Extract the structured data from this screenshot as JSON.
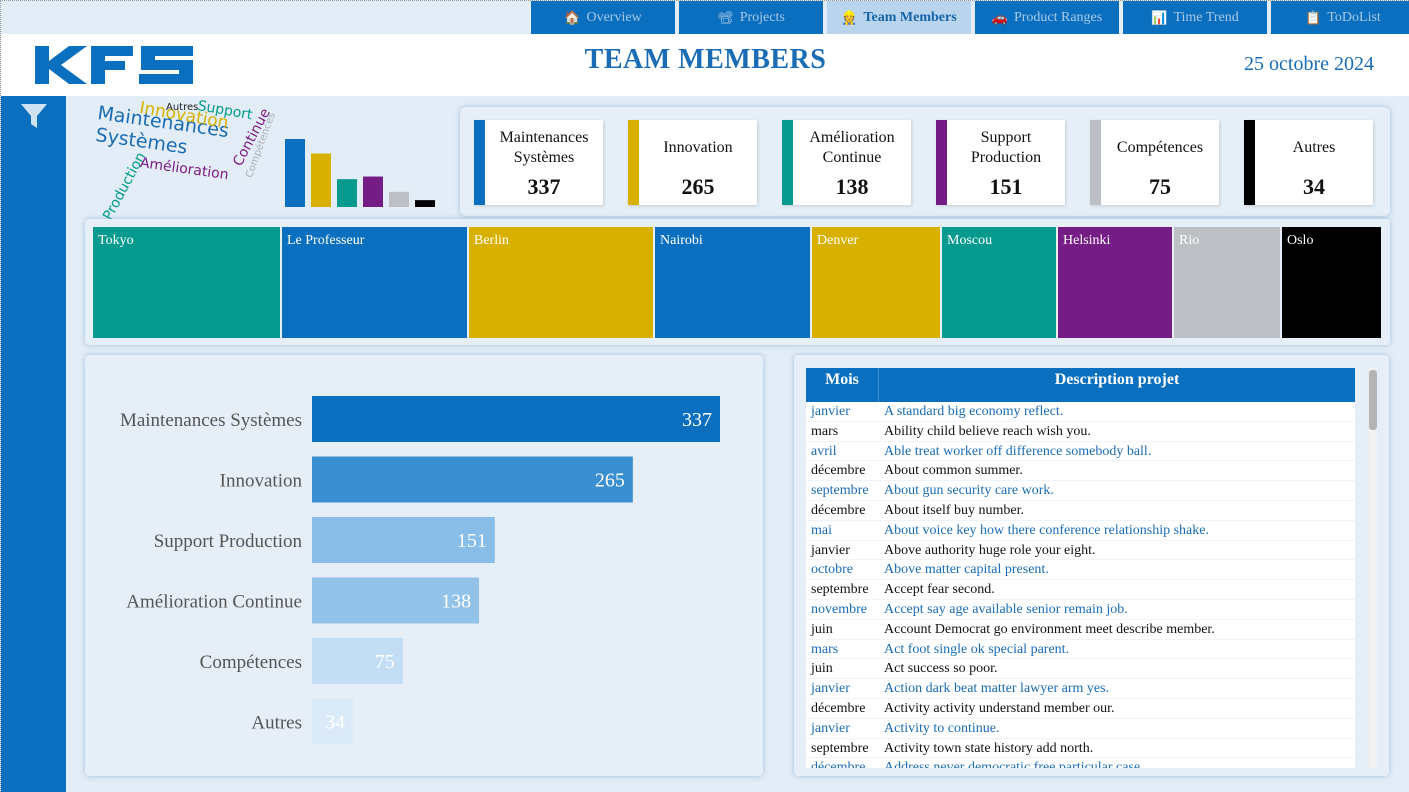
{
  "nav": {
    "tabs": [
      {
        "label": "Overview",
        "icon": "house-icon",
        "glyph": "🏠"
      },
      {
        "label": "Projects",
        "icon": "film-projector-icon",
        "glyph": "📽"
      },
      {
        "label": "Team Members",
        "icon": "team-icon",
        "glyph": "👷"
      },
      {
        "label": "Product Ranges",
        "icon": "car-icon",
        "glyph": "🚗"
      },
      {
        "label": "Time Trend",
        "icon": "chart-icon",
        "glyph": "📊"
      },
      {
        "label": "ToDoList",
        "icon": "notepad-icon",
        "glyph": "📋"
      }
    ],
    "active": "Team Members"
  },
  "header": {
    "logo": "KFS",
    "title": "TEAM MEMBERS",
    "date": "25 octobre 2024"
  },
  "sidebar": {
    "icon": "filter-icon"
  },
  "wordcloud": {
    "words": [
      {
        "text": "Maintenances",
        "color": "#1a6cb5"
      },
      {
        "text": "Systèmes",
        "color": "#1a6cb5"
      },
      {
        "text": "Innovation",
        "color": "#d6b300"
      },
      {
        "text": "Support",
        "color": "#009b8c"
      },
      {
        "text": "Autres",
        "color": "#222222"
      },
      {
        "text": "Continue",
        "color": "#7a1b86"
      },
      {
        "text": "Compétences",
        "color": "#aab0b5"
      },
      {
        "text": "Production",
        "color": "#009b8c"
      },
      {
        "text": "Amélioration",
        "color": "#7a1b86"
      }
    ]
  },
  "kpis": [
    {
      "label": "Maintenances Systèmes",
      "value": "337",
      "color": "#0a6fbf"
    },
    {
      "label": "Innovation",
      "value": "265",
      "color": "#d8b000"
    },
    {
      "label": "Amélioration Continue",
      "value": "138",
      "color": "#079b90"
    },
    {
      "label": "Support Production",
      "value": "151",
      "color": "#761d85"
    },
    {
      "label": "Compétences",
      "value": "75",
      "color": "#bcc0c4"
    },
    {
      "label": "Autres",
      "value": "34",
      "color": "#000000"
    }
  ],
  "mini_chart": {
    "values": [
      337,
      265,
      138,
      151,
      75,
      34
    ],
    "colors": [
      "#0a6fbf",
      "#d8b000",
      "#079b90",
      "#761d85",
      "#bcc0c4",
      "#000000"
    ]
  },
  "treemap": [
    {
      "name": "Tokyo",
      "color": "#079b90"
    },
    {
      "name": "Le Professeur",
      "color": "#0a6fbf"
    },
    {
      "name": "Berlin",
      "color": "#d8b000"
    },
    {
      "name": "Nairobi",
      "color": "#0a6fbf"
    },
    {
      "name": "Denver",
      "color": "#d8b000"
    },
    {
      "name": "Moscou",
      "color": "#079b90"
    },
    {
      "name": "Helsinki",
      "color": "#761d85"
    },
    {
      "name": "Rio",
      "color": "#bcc0c4"
    },
    {
      "name": "Oslo",
      "color": "#000000"
    }
  ],
  "chart_data": {
    "type": "bar",
    "orientation": "horizontal",
    "categories": [
      "Maintenances Systèmes",
      "Innovation",
      "Support Production",
      "Amélioration Continue",
      "Compétences",
      "Autres"
    ],
    "values": [
      337,
      265,
      151,
      138,
      75,
      34
    ],
    "colors": [
      "#0a6fbf",
      "#3a8fd0",
      "#87bde6",
      "#92c2e8",
      "#c2ddf4",
      "#dbeaf8"
    ],
    "xlim": [
      0,
      337
    ],
    "data_labels": true
  },
  "table": {
    "headers": [
      "Mois",
      "Description projet"
    ],
    "rows": [
      [
        "janvier",
        "A standard big economy reflect."
      ],
      [
        "mars",
        "Ability child believe reach wish you."
      ],
      [
        "avril",
        "Able treat worker off difference somebody ball."
      ],
      [
        "décembre",
        "About common summer."
      ],
      [
        "septembre",
        "About gun security care work."
      ],
      [
        "décembre",
        "About itself buy number."
      ],
      [
        "mai",
        "About voice key how there conference relationship shake."
      ],
      [
        "janvier",
        "Above authority huge role your eight."
      ],
      [
        "octobre",
        "Above matter capital present."
      ],
      [
        "septembre",
        "Accept fear second."
      ],
      [
        "novembre",
        "Accept say age available senior remain job."
      ],
      [
        "juin",
        "Account Democrat go environment meet describe member."
      ],
      [
        "mars",
        "Act foot single ok special parent."
      ],
      [
        "juin",
        "Act success so poor."
      ],
      [
        "janvier",
        "Action dark beat matter lawyer arm yes."
      ],
      [
        "décembre",
        "Activity activity understand member our."
      ],
      [
        "janvier",
        "Activity to continue."
      ],
      [
        "septembre",
        "Activity town state history add north."
      ],
      [
        "décembre",
        "Address never democratic free particular case."
      ]
    ]
  }
}
